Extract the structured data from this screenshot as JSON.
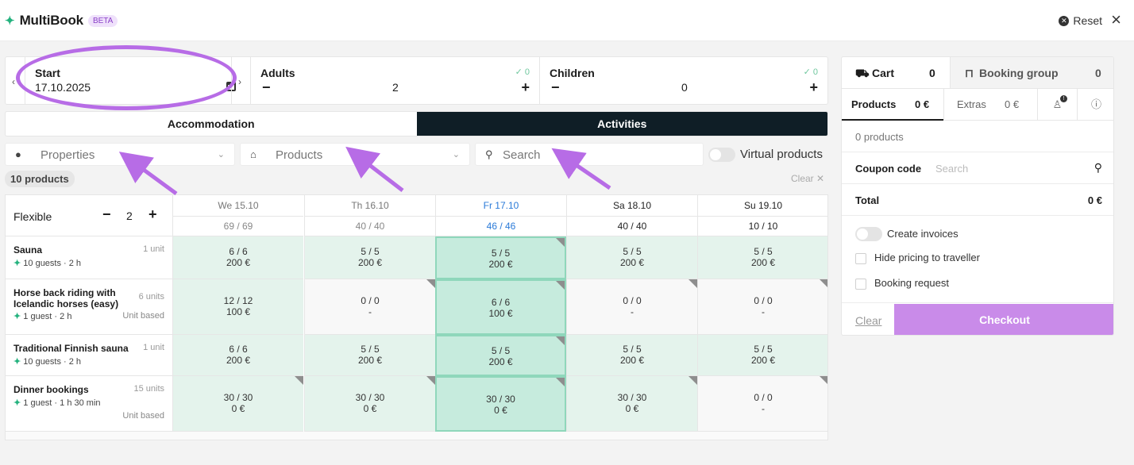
{
  "header": {
    "brand": "MultiBook",
    "beta": "BETA",
    "reset": "Reset",
    "close": "×"
  },
  "guests": {
    "start_label": "Start",
    "start_date": "17.10.2025",
    "prev": "‹",
    "next": "›",
    "adults_label": "Adults",
    "adults_value": "2",
    "adults_check": "✓ 0",
    "children_label": "Children",
    "children_value": "0",
    "children_check": "✓ 0",
    "minus": "−",
    "plus": "+"
  },
  "tabs": {
    "accommodation": "Accommodation",
    "activities": "Activities"
  },
  "filters": {
    "properties": "Properties",
    "products": "Products",
    "search": "Search",
    "virtual_products": "Virtual products",
    "pin_icon": "pin-icon",
    "home_icon": "home-icon",
    "search_icon": "search-icon"
  },
  "list": {
    "count": "10 products",
    "clear": "Clear ✕"
  },
  "grid": {
    "flexible_label": "Flexible",
    "flexible_value": "2",
    "minus": "−",
    "plus": "+",
    "days": [
      {
        "label": "We 15.10",
        "capacity": "69 / 69"
      },
      {
        "label": "Th 16.10",
        "capacity": "40 / 40"
      },
      {
        "label": "Fr 17.10",
        "capacity": "46 / 46"
      },
      {
        "label": "Sa 18.10",
        "capacity": "40 / 40"
      },
      {
        "label": "Su 19.10",
        "capacity": "10 / 10"
      }
    ],
    "products": [
      {
        "name": "Sauna",
        "units": "1 unit",
        "meta": "10 guests · 2 h",
        "based": "",
        "cells": [
          {
            "avail": "6 / 6",
            "price": "200 €"
          },
          {
            "avail": "5 / 5",
            "price": "200 €"
          },
          {
            "avail": "5 / 5",
            "price": "200 €"
          },
          {
            "avail": "5 / 5",
            "price": "200 €"
          },
          {
            "avail": "5 / 5",
            "price": "200 €"
          }
        ]
      },
      {
        "name": "Horse back riding with Icelandic horses (easy)",
        "units": "6 units",
        "meta": "1 guest · 2 h",
        "based": "Unit based",
        "cells": [
          {
            "avail": "12 / 12",
            "price": "100 €"
          },
          {
            "avail": "0 / 0",
            "price": "-"
          },
          {
            "avail": "6 / 6",
            "price": "100 €"
          },
          {
            "avail": "0 / 0",
            "price": "-"
          },
          {
            "avail": "0 / 0",
            "price": "-"
          }
        ]
      },
      {
        "name": "Traditional Finnish sauna",
        "units": "1 unit",
        "meta": "10 guests · 2 h",
        "based": "",
        "cells": [
          {
            "avail": "6 / 6",
            "price": "200 €"
          },
          {
            "avail": "5 / 5",
            "price": "200 €"
          },
          {
            "avail": "5 / 5",
            "price": "200 €"
          },
          {
            "avail": "5 / 5",
            "price": "200 €"
          },
          {
            "avail": "5 / 5",
            "price": "200 €"
          }
        ]
      },
      {
        "name": "Dinner bookings",
        "units": "15 units",
        "meta": "1 guest · 1 h 30 min",
        "based": "Unit based",
        "cells": [
          {
            "avail": "30 / 30",
            "price": "0 €"
          },
          {
            "avail": "30 / 30",
            "price": "0 €"
          },
          {
            "avail": "30 / 30",
            "price": "0 €"
          },
          {
            "avail": "30 / 30",
            "price": "0 €"
          },
          {
            "avail": "0 / 0",
            "price": "-"
          }
        ]
      }
    ]
  },
  "cart": {
    "cart_label": "Cart",
    "cart_count": "0",
    "group_label": "Booking group",
    "group_count": "0",
    "products_tab": "Products",
    "products_total": "0 €",
    "extras_tab": "Extras",
    "extras_total": "0 €",
    "person_badge": "!",
    "products_count": "0 products",
    "coupon_label": "Coupon code",
    "coupon_placeholder": "Search",
    "total_label": "Total",
    "total_value": "0 €",
    "create_invoices": "Create invoices",
    "hide_pricing": "Hide pricing to traveller",
    "booking_request": "Booking request",
    "clear": "Clear",
    "checkout": "Checkout"
  },
  "colors": {
    "accent": "#b76ce6",
    "brand_green": "#24b27e",
    "dark_tab": "#0f1e26",
    "checkout": "#c98be9",
    "available_cell": "#e4f3ec"
  }
}
